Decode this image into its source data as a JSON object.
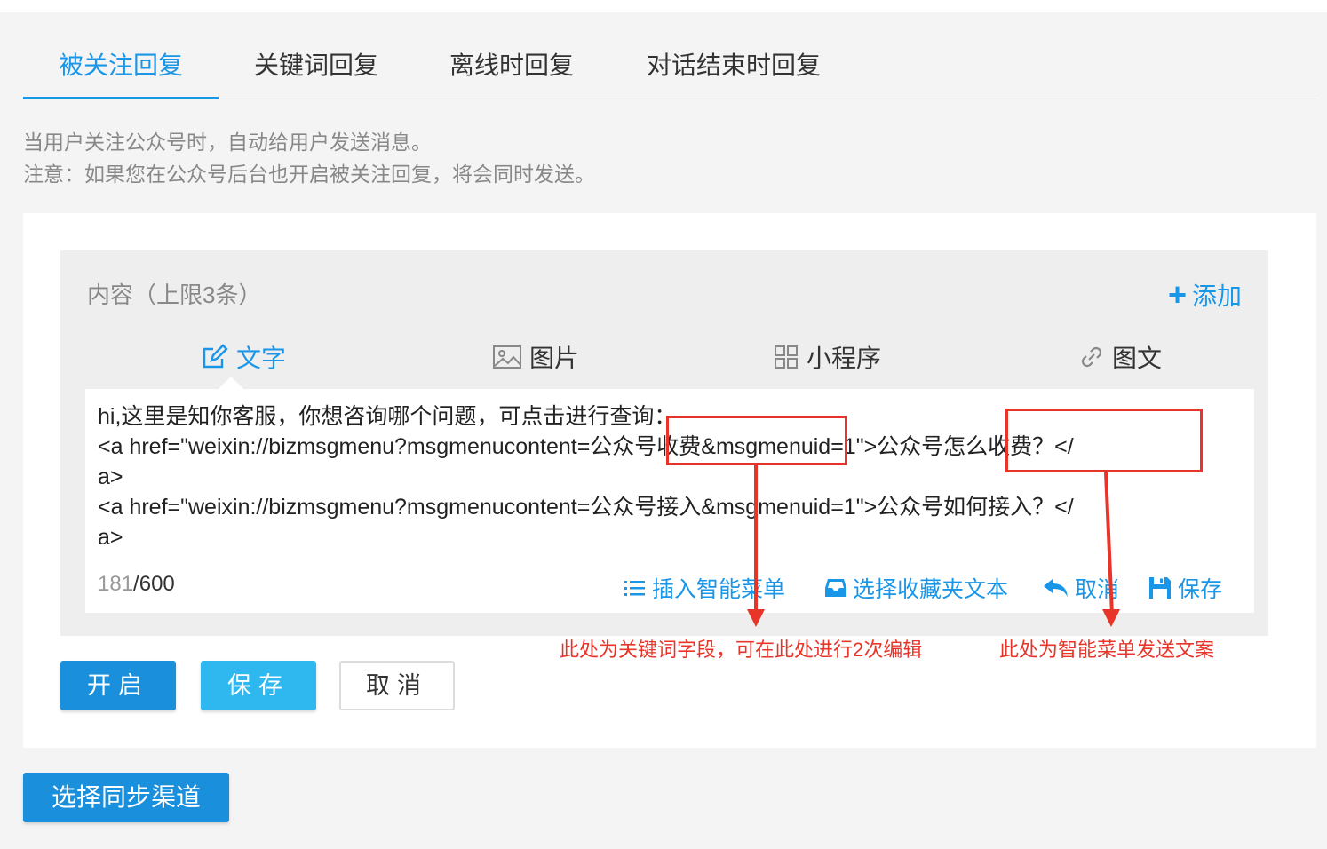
{
  "tabs": [
    {
      "label": "被关注回复",
      "active": true
    },
    {
      "label": "关键词回复",
      "active": false
    },
    {
      "label": "离线时回复",
      "active": false
    },
    {
      "label": "对话结束时回复",
      "active": false
    }
  ],
  "description": {
    "line1": "当用户关注公众号时，自动给用户发送消息。",
    "line2": "注意：如果您在公众号后台也开启被关注回复，将会同时发送。"
  },
  "content_panel": {
    "title": "内容（上限3条）",
    "add_label": "添加",
    "types": [
      {
        "label": "文字",
        "icon": "edit-icon",
        "active": true
      },
      {
        "label": "图片",
        "icon": "image-icon",
        "active": false
      },
      {
        "label": "小程序",
        "icon": "grid-icon",
        "active": false
      },
      {
        "label": "图文",
        "icon": "link-icon",
        "active": false
      }
    ],
    "editor": {
      "lines": [
        "hi,这里是知你客服，你想咨询哪个问题，可点击进行查询：",
        "<a href=\"weixin://bizmsgmenu?msgmenucontent=公众号收费&msgmenuid=1\">公众号怎么收费？</",
        "a>",
        "<a href=\"weixin://bizmsgmenu?msgmenucontent=公众号接入&msgmenuid=1\">公众号如何接入？</",
        "a>"
      ],
      "count_current": "181",
      "count_max": "/600"
    },
    "tools": [
      {
        "label": "插入智能菜单",
        "icon": "list-icon"
      },
      {
        "label": "选择收藏夹文本",
        "icon": "inbox-icon"
      },
      {
        "label": "取消",
        "icon": "undo-icon"
      },
      {
        "label": "保存",
        "icon": "floppy-icon"
      }
    ]
  },
  "annotations": {
    "keyword_note": "此处为关键词字段，可在此处进行2次编辑",
    "menu_note": "此处为智能菜单发送文案"
  },
  "buttons": {
    "open": "开启",
    "save": "保存",
    "cancel": "取消",
    "sync": "选择同步渠道"
  },
  "colors": {
    "accent": "#1a96e8",
    "annotation": "#e8352a"
  }
}
